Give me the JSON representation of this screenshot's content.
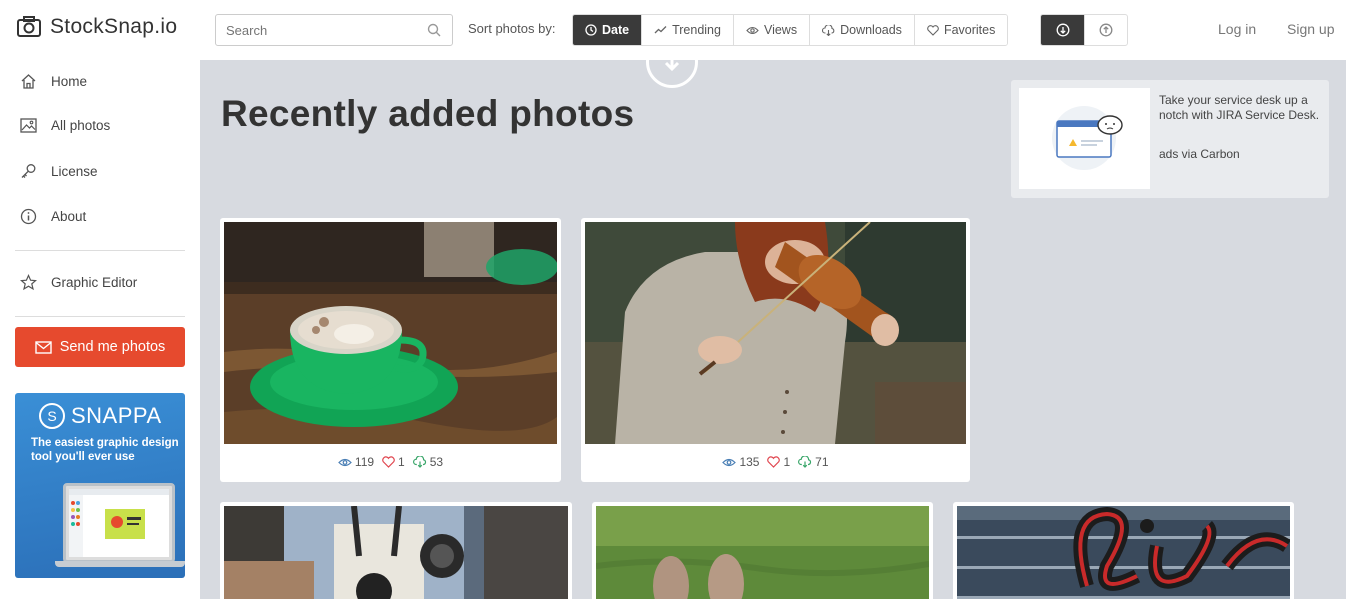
{
  "header": {
    "logo_text": "StockSnap.io",
    "search_placeholder": "Search",
    "sort_label": "Sort photos by:",
    "sort_options": [
      {
        "label": "Date",
        "icon": "clock-icon",
        "active": true
      },
      {
        "label": "Trending",
        "icon": "trend-icon",
        "active": false
      },
      {
        "label": "Views",
        "icon": "eye-icon",
        "active": false
      },
      {
        "label": "Downloads",
        "icon": "cloud-download-icon",
        "active": false
      },
      {
        "label": "Favorites",
        "icon": "heart-icon",
        "active": false
      }
    ],
    "login": "Log in",
    "signup": "Sign up"
  },
  "sidebar": {
    "items": [
      {
        "label": "Home",
        "icon": "home-icon"
      },
      {
        "label": "All photos",
        "icon": "image-icon"
      },
      {
        "label": "License",
        "icon": "key-icon"
      },
      {
        "label": "About",
        "icon": "info-icon"
      },
      {
        "label": "Graphic Editor",
        "icon": "star-icon"
      }
    ],
    "send_button": "Send me photos",
    "snappa": {
      "name": "SNAPPA",
      "letter": "S",
      "tagline": "The easiest graphic design tool you'll ever use"
    }
  },
  "main": {
    "title": "Recently added photos",
    "ad": {
      "text": "Take your service desk up a notch with JIRA Service Desk.",
      "via": "ads via Carbon"
    },
    "photos": [
      {
        "views": "119",
        "likes": "1",
        "downloads": "53"
      },
      {
        "views": "135",
        "likes": "1",
        "downloads": "71"
      }
    ]
  },
  "colors": {
    "accent": "#e64a2e",
    "active_sort": "#3a3a3a",
    "main_bg": "#d7dae0",
    "snappa_blue": "#2f7cc6"
  }
}
